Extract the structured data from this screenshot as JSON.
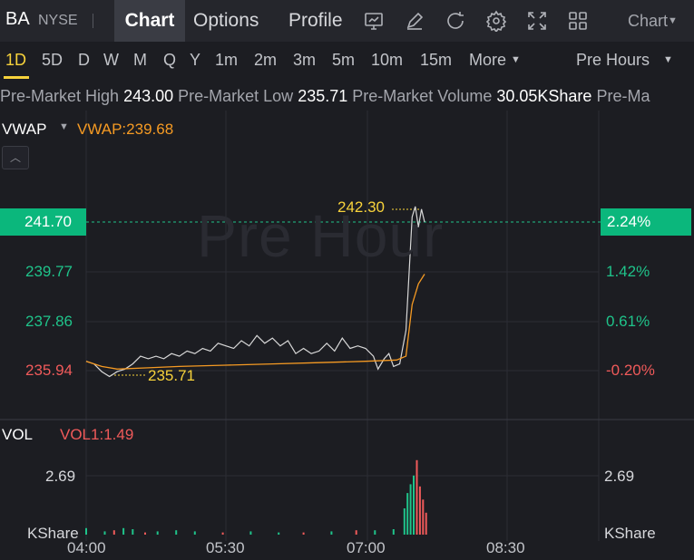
{
  "header": {
    "symbol": "BA",
    "exchange": "NYSE",
    "tabs": [
      {
        "label": "Chart",
        "active": true
      },
      {
        "label": "Options",
        "active": false
      },
      {
        "label": "Profile",
        "active": false
      }
    ],
    "tools": [
      "monitor-chart-icon",
      "pencil-icon",
      "refresh-icon",
      "settings-gear-icon",
      "fullscreen-icon",
      "grid-layout-icon"
    ],
    "chart_menu_label": "Chart"
  },
  "timeframes": {
    "items": [
      "1D",
      "5D",
      "D",
      "W",
      "M",
      "Q",
      "Y",
      "1m",
      "2m",
      "3m",
      "5m",
      "10m",
      "15m"
    ],
    "active": "1D",
    "more_label": "More",
    "session_label": "Pre Hours"
  },
  "info": {
    "high_label": "Pre-Market High",
    "high_value": "243.00",
    "low_label": "Pre-Market Low",
    "low_value": "235.71",
    "volume_label": "Pre-Market Volume",
    "volume_value": "30.05KShare",
    "trailing_label": "Pre-Ma"
  },
  "indicator": {
    "name": "VWAP",
    "value_label": "VWAP:239.68",
    "color": "#f59a23"
  },
  "price_axis": {
    "current_price": "241.70",
    "current_pct": "2.24%",
    "left_ticks": [
      {
        "label": "239.77",
        "color": "#1fc38a"
      },
      {
        "label": "237.86",
        "color": "#1fc38a"
      },
      {
        "label": "235.94",
        "color": "#f05a5a"
      }
    ],
    "right_ticks": [
      {
        "label": "1.42%",
        "color": "#1fc38a"
      },
      {
        "label": "0.61%",
        "color": "#1fc38a"
      },
      {
        "label": "-0.20%",
        "color": "#f05a5a"
      }
    ]
  },
  "annotations": {
    "high_marker": "242.30",
    "low_marker": "235.71"
  },
  "watermark": "Pre Hour",
  "volume": {
    "name": "VOL",
    "value_label": "VOL1:1.49",
    "axis_value": "2.69",
    "unit": "KShare"
  },
  "x_axis": [
    "04:00",
    "05:30",
    "07:00",
    "08:30"
  ],
  "colors": {
    "up": "#1fc38a",
    "down": "#f05a5a",
    "accent": "#f7d23b",
    "price_line": "#d8d8d8",
    "vwap_line": "#f59a23",
    "tag_bg": "#0bb77c"
  },
  "chart_data": {
    "type": "line",
    "title": "",
    "xlabel": "",
    "ylabel": "",
    "x_range": [
      "04:00",
      "09:30"
    ],
    "ylim": [
      235.2,
      242.8
    ],
    "grid": true,
    "series": [
      {
        "name": "",
        "x_minutes_from_0400": [
          0,
          5,
          10,
          15,
          20,
          25,
          30,
          35,
          40,
          45,
          50,
          55,
          60,
          65,
          70,
          75,
          80,
          85,
          90,
          95,
          100,
          105,
          110,
          115,
          120,
          125,
          130,
          135,
          140,
          145,
          150,
          155,
          160,
          165,
          170,
          175,
          180,
          185,
          188,
          192,
          195,
          198,
          202,
          206,
          210,
          212,
          214,
          216,
          218
        ],
        "values": [
          236.3,
          236.2,
          235.9,
          235.71,
          235.9,
          236.0,
          236.2,
          236.5,
          236.4,
          236.5,
          236.4,
          236.6,
          236.5,
          236.7,
          236.6,
          236.8,
          236.7,
          237.0,
          236.9,
          236.8,
          237.1,
          236.9,
          237.3,
          237.0,
          237.2,
          236.9,
          237.1,
          236.6,
          236.8,
          236.6,
          236.7,
          237.0,
          236.7,
          237.2,
          236.8,
          236.9,
          236.8,
          236.5,
          236.0,
          236.4,
          236.6,
          236.1,
          236.2,
          237.5,
          241.9,
          242.3,
          241.5,
          242.2,
          241.7
        ]
      },
      {
        "name": "VWAP",
        "x_minutes_from_0400": [
          0,
          10,
          20,
          40,
          60,
          90,
          120,
          150,
          180,
          200,
          206,
          210,
          214,
          218
        ],
        "values": [
          236.3,
          236.1,
          236.0,
          236.05,
          236.1,
          236.15,
          236.2,
          236.25,
          236.3,
          236.35,
          236.5,
          238.5,
          239.3,
          239.68
        ]
      }
    ],
    "volume_series": {
      "name": "VOL",
      "unit": "KShare",
      "x_minutes_from_0400": [
        0,
        12,
        18,
        24,
        30,
        38,
        46,
        58,
        70,
        88,
        106,
        124,
        140,
        158,
        174,
        186,
        198,
        205,
        207,
        209,
        211,
        213,
        215,
        217,
        219
      ],
      "values": [
        0.3,
        0.15,
        0.2,
        0.3,
        0.25,
        0.1,
        0.15,
        0.2,
        0.15,
        0.1,
        0.15,
        0.1,
        0.1,
        0.15,
        0.2,
        0.2,
        0.25,
        1.2,
        1.9,
        2.3,
        2.7,
        3.4,
        2.2,
        1.6,
        1.0
      ],
      "direction": [
        "up",
        "up",
        "down",
        "up",
        "up",
        "down",
        "up",
        "up",
        "up",
        "down",
        "up",
        "up",
        "down",
        "up",
        "down",
        "up",
        "up",
        "up",
        "up",
        "up",
        "up",
        "down",
        "down",
        "down",
        "down"
      ]
    }
  }
}
